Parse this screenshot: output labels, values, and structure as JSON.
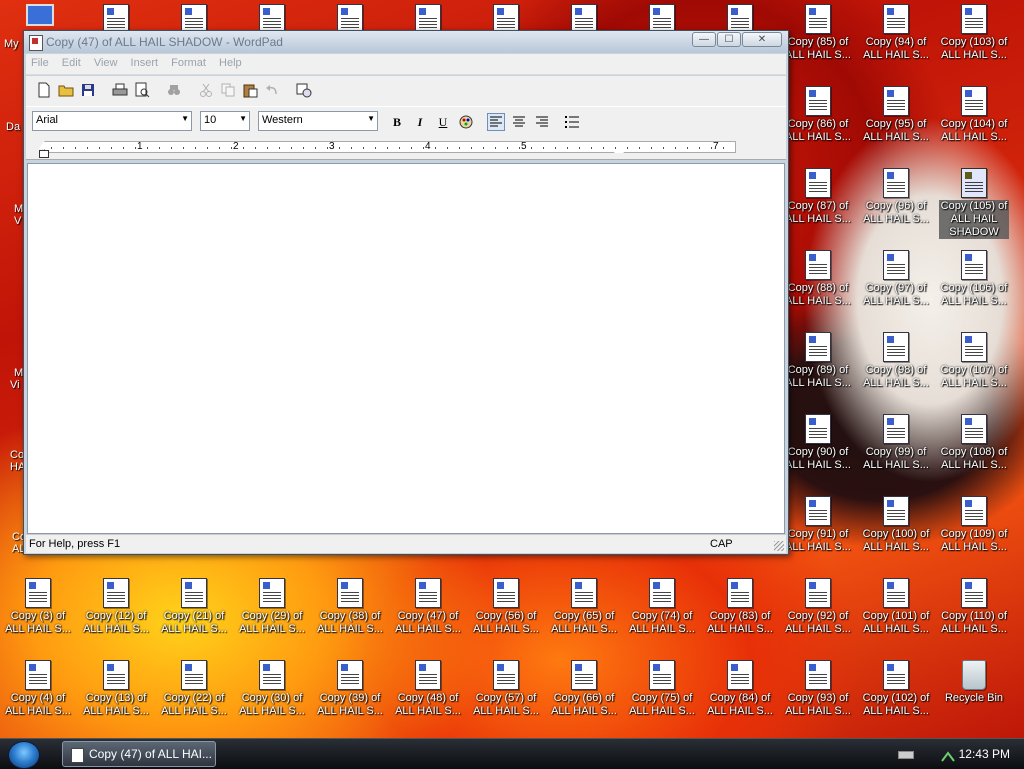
{
  "window": {
    "title": "Copy (47) of ALL HAIL SHADOW - WordPad",
    "buttons": {
      "minimize": "—",
      "maximize": "☐",
      "close": "✕"
    }
  },
  "menu": [
    "File",
    "Edit",
    "View",
    "Insert",
    "Format",
    "Help"
  ],
  "format_bar": {
    "font": "Arial",
    "size": "10",
    "script": "Western",
    "bold": "B",
    "italic": "I",
    "underline": "U"
  },
  "ruler": {
    "numbers": [
      "1",
      "2",
      "3",
      "4",
      "5",
      "7"
    ]
  },
  "status": {
    "help": "For Help, press F1",
    "caps": "CAP"
  },
  "taskbar": {
    "task_label": "Copy (47) of ALL HAI...",
    "clock": "12:43 PM"
  },
  "desktop": {
    "left_partial": [
      "My",
      "Da",
      "M",
      "V",
      "M",
      "Vi",
      "Co",
      "HA",
      "Co",
      "AL"
    ],
    "icons": [
      {
        "l1": "Copy (85) of",
        "l2": "ALL HAIL S..."
      },
      {
        "l1": "Copy (94) of",
        "l2": "ALL HAIL S..."
      },
      {
        "l1": "Copy (103) of",
        "l2": "ALL HAIL S..."
      },
      {
        "l1": "Copy (86) of",
        "l2": "ALL HAIL S..."
      },
      {
        "l1": "Copy (95) of",
        "l2": "ALL HAIL S..."
      },
      {
        "l1": "Copy (104) of",
        "l2": "ALL HAIL S..."
      },
      {
        "l1": "Copy (87) of",
        "l2": "ALL HAIL S..."
      },
      {
        "l1": "Copy (96) of",
        "l2": "ALL HAIL S..."
      },
      {
        "l1": "Copy (105) of",
        "l2": "ALL HAIL SHADOW"
      },
      {
        "l1": "Copy (88) of",
        "l2": "ALL HAIL S..."
      },
      {
        "l1": "Copy (97) of",
        "l2": "ALL HAIL S..."
      },
      {
        "l1": "Copy (106) of",
        "l2": "ALL HAIL S..."
      },
      {
        "l1": "Copy (89) of",
        "l2": "ALL HAIL S..."
      },
      {
        "l1": "Copy (98) of",
        "l2": "ALL HAIL S..."
      },
      {
        "l1": "Copy (107) of",
        "l2": "ALL HAIL S..."
      },
      {
        "l1": "Copy (90) of",
        "l2": "ALL HAIL S..."
      },
      {
        "l1": "Copy (99) of",
        "l2": "ALL HAIL S..."
      },
      {
        "l1": "Copy (108) of",
        "l2": "ALL HAIL S..."
      },
      {
        "l1": "Copy (91) of",
        "l2": "ALL HAIL S..."
      },
      {
        "l1": "Copy (100) of",
        "l2": "ALL HAIL S..."
      },
      {
        "l1": "Copy (109) of",
        "l2": "ALL HAIL S..."
      },
      {
        "l1": "Copy (3) of",
        "l2": "ALL HAIL S..."
      },
      {
        "l1": "Copy (12) of",
        "l2": "ALL HAIL S..."
      },
      {
        "l1": "Copy (21) of",
        "l2": "ALL HAIL S..."
      },
      {
        "l1": "Copy (29) of",
        "l2": "ALL HAIL S..."
      },
      {
        "l1": "Copy (38) of",
        "l2": "ALL HAIL S..."
      },
      {
        "l1": "Copy (47) of",
        "l2": "ALL HAIL S..."
      },
      {
        "l1": "Copy (56) of",
        "l2": "ALL HAIL S..."
      },
      {
        "l1": "Copy (65) of",
        "l2": "ALL HAIL S..."
      },
      {
        "l1": "Copy (74) of",
        "l2": "ALL HAIL S..."
      },
      {
        "l1": "Copy (83) of",
        "l2": "ALL HAIL S..."
      },
      {
        "l1": "Copy (92) of",
        "l2": "ALL HAIL S..."
      },
      {
        "l1": "Copy (101) of",
        "l2": "ALL HAIL S..."
      },
      {
        "l1": "Copy (110) of",
        "l2": "ALL HAIL S..."
      },
      {
        "l1": "Copy (4) of",
        "l2": "ALL HAIL S..."
      },
      {
        "l1": "Copy (13) of",
        "l2": "ALL HAIL S..."
      },
      {
        "l1": "Copy (22) of",
        "l2": "ALL HAIL S..."
      },
      {
        "l1": "Copy (30) of",
        "l2": "ALL HAIL S..."
      },
      {
        "l1": "Copy (39) of",
        "l2": "ALL HAIL S..."
      },
      {
        "l1": "Copy (48) of",
        "l2": "ALL HAIL S..."
      },
      {
        "l1": "Copy (57) of",
        "l2": "ALL HAIL S..."
      },
      {
        "l1": "Copy (66) of",
        "l2": "ALL HAIL S..."
      },
      {
        "l1": "Copy (75) of",
        "l2": "ALL HAIL S..."
      },
      {
        "l1": "Copy (84) of",
        "l2": "ALL HAIL S..."
      },
      {
        "l1": "Copy (93) of",
        "l2": "ALL HAIL S..."
      },
      {
        "l1": "Copy (102) of",
        "l2": "ALL HAIL S..."
      }
    ],
    "recycle_bin": "Recycle Bin"
  }
}
